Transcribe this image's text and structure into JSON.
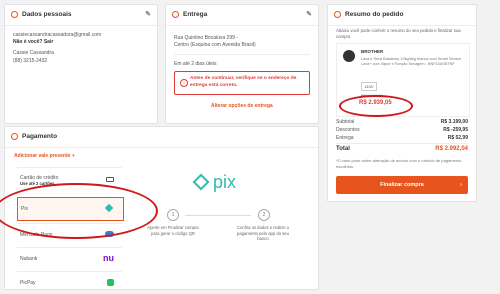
{
  "personal": {
    "title": "Dados pessoais",
    "email": "cassiecassandracassadora@gmail.com",
    "not_you": "Não é você? Sair",
    "name": "Cassie Cassandra",
    "phone": "(88) 3215-2432"
  },
  "delivery": {
    "title": "Entrega",
    "street": "Rua Quintino Bocaiúva 299 -",
    "district": "Centro (Esquina com Avenida Brasil)",
    "eta": "Em até 2 dias úteis",
    "alert": "Antes de continuar, verifique se o endereço de entrega está correto.",
    "change_link": "Alterar opções de entrega"
  },
  "payment": {
    "title": "Pagamento",
    "add_voucher": "Adicionar vale presente",
    "methods": [
      {
        "label": "Cartão de crédito",
        "sub": "Use até 2 cartões",
        "icon": "card-icon"
      },
      {
        "label": "Pix",
        "sub": "",
        "icon": "pix-icon"
      },
      {
        "label": "Mercado Pago",
        "sub": "",
        "icon": "mercadopago-icon"
      },
      {
        "label": "Nubank",
        "sub": "",
        "icon": "nubank-icon"
      },
      {
        "label": "PicPay",
        "sub": "",
        "icon": "picpay-icon"
      }
    ],
    "pix_logo": "pix",
    "steps": [
      {
        "num": "1",
        "text": "Aperte em Finalizar compra para gerar o código QR"
      },
      {
        "num": "2",
        "text": "Confira os dados e realize o pagamento pelo app do seu banco"
      }
    ]
  },
  "summary": {
    "title": "Resumo do pedido",
    "intro": "Abaixo você pode conferir o resumo do seu pedido e finalizar sua compra",
    "product_name": "BROTHER",
    "product_desc": "Lava e Seca Brastemp 10kg/6kg branca com Smart Sensor Lava+ com Vapor e Função Secagem - BNF10ASBTNF",
    "voltage": "110V",
    "old_price": "R$ 3.199,00",
    "price": "R$ 2.939,05",
    "rows": [
      {
        "label": "Subtotal",
        "value": "R$ 3.199,00"
      },
      {
        "label": "Descontos",
        "value": "R$ -259,95"
      },
      {
        "label": "Entrega",
        "value": "R$ 52,99"
      }
    ],
    "total_label": "Total",
    "total_value": "R$ 2.992,04",
    "note": "*O valor pode sofrer alteração de acordo com o método de pagamento escolhido.",
    "finish_button": "Finalizar compra"
  },
  "colors": {
    "accent": "#e8541e",
    "annotation": "#d01818",
    "pix": "#32bcad",
    "nubank": "#820ad1"
  }
}
